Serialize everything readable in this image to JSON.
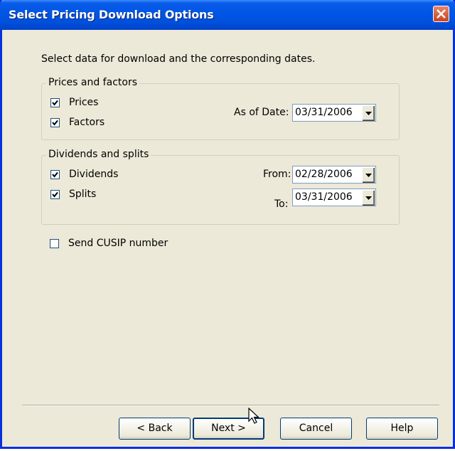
{
  "window": {
    "title": "Select Pricing Download Options"
  },
  "instructions": "Select data for download and the corresponding dates.",
  "prices_group": {
    "legend": "Prices and factors",
    "prices": {
      "label": "Prices",
      "checked": true
    },
    "factors": {
      "label": "Factors",
      "checked": true
    },
    "as_of_label": "As of Date:",
    "as_of_value": "03/31/2006"
  },
  "dividends_group": {
    "legend": "Dividends and splits",
    "dividends": {
      "label": "Dividends",
      "checked": true
    },
    "splits": {
      "label": "Splits",
      "checked": true
    },
    "from_label": "From:",
    "from_value": "02/28/2006",
    "to_label": "To:",
    "to_value": "03/31/2006"
  },
  "send_cusip": {
    "label": "Send CUSIP number",
    "checked": false
  },
  "buttons": {
    "back": "< Back",
    "next": "Next >",
    "cancel": "Cancel",
    "help": "Help"
  },
  "colors": {
    "titlebar": "#0055e5",
    "dialog_bg": "#ece9d8",
    "close": "#c9431f"
  }
}
